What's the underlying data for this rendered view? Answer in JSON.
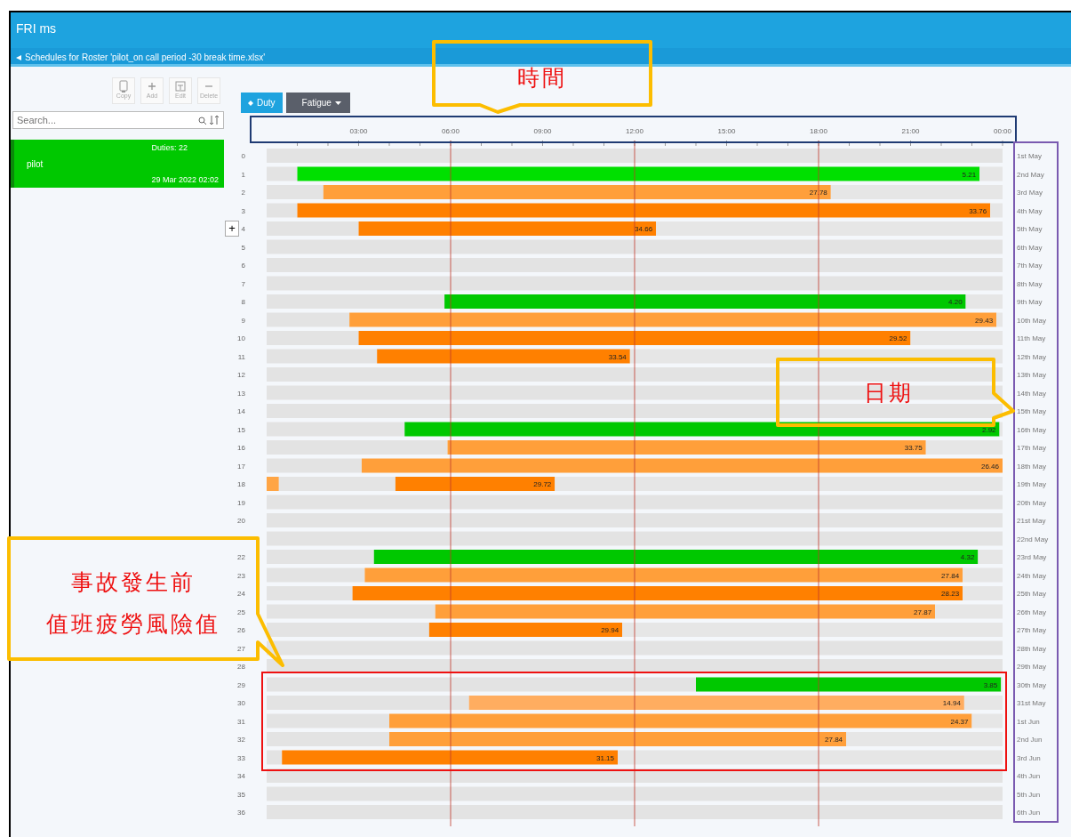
{
  "header": {
    "title": "FRI ms",
    "subtitle": "Schedules for Roster 'pilot_on call period -30 break time.xlsx'"
  },
  "toolbar": [
    {
      "kind": "copy",
      "label": "Copy"
    },
    {
      "kind": "add",
      "label": "Add"
    },
    {
      "kind": "edit",
      "label": "Edit"
    },
    {
      "kind": "delete",
      "label": "Delete"
    }
  ],
  "search": {
    "placeholder": "Search..."
  },
  "rosters": [
    {
      "name": "pilot",
      "duties": "Duties: 22",
      "date": "29 Mar 2022 02:02",
      "selected": true
    }
  ],
  "view_buttons": [
    {
      "kind": "duty",
      "label": "Duty",
      "selected": true
    },
    {
      "kind": "fatigue",
      "label": "Fatigue",
      "selected": false
    }
  ],
  "expand_button": {
    "label": "+"
  },
  "chart": {
    "dates": [
      "1st May",
      "2nd May",
      "3rd May",
      "4th May",
      "5th May",
      "6th May",
      "7th May",
      "8th May",
      "9th May",
      "10th May",
      "11th May",
      "12th May",
      "13th May",
      "14th May",
      "15th May",
      "16th May",
      "17th May",
      "18th May",
      "19th May",
      "20th May",
      "21st May",
      "22nd May",
      "23rd May",
      "24th May",
      "25th May",
      "26th May",
      "27th May",
      "28th May",
      "29th May",
      "30th May",
      "31st May",
      "1st Jun",
      "2nd Jun",
      "3rd Jun",
      "4th Jun",
      "5th Jun",
      "6th Jun"
    ],
    "chart_data": {
      "type": "bar",
      "orientation": "horizontal",
      "stacked": true,
      "grid": true,
      "xlim": [
        0,
        24
      ],
      "xticks": [
        {
          "value": 3,
          "label": "03:00"
        },
        {
          "value": 6,
          "label": "06:00"
        },
        {
          "value": 9,
          "label": "09:00"
        },
        {
          "value": 12,
          "label": "12:00"
        },
        {
          "value": 15,
          "label": "15:00"
        },
        {
          "value": 18,
          "label": "18:00"
        },
        {
          "value": 21,
          "label": "21:00"
        },
        {
          "value": 24,
          "label": "00:00"
        }
      ],
      "categories": [
        "0",
        "1",
        "2",
        "3",
        "4",
        "5",
        "6",
        "7",
        "8",
        "9",
        "10",
        "11",
        "12",
        "13",
        "14",
        "15",
        "16",
        "17",
        "18",
        "19",
        "20",
        null,
        "22",
        "23",
        "24",
        "25",
        "26",
        "27",
        "28",
        "29",
        "30",
        "31",
        "32",
        "33",
        "34",
        "35",
        "36"
      ],
      "series": [
        {
          "color": "#e3e3e3",
          "values": [
            24,
            1.0,
            1.85,
            1.0,
            3.0,
            24,
            24,
            24,
            5.8,
            2.7,
            3.0,
            3.6,
            24,
            24,
            24,
            4.5,
            5.9,
            3.1,
            null,
            24,
            24,
            24,
            3.5,
            3.2,
            2.8,
            5.5,
            5.3,
            24,
            24,
            14.0,
            6.6,
            4.0,
            4.0,
            0.5,
            24,
            24,
            24
          ]
        },
        {
          "color": "#ffa545",
          "values": [
            null,
            null,
            null,
            null,
            null,
            null,
            null,
            null,
            null,
            null,
            null,
            null,
            null,
            null,
            null,
            null,
            null,
            null,
            0.4,
            null,
            null,
            null,
            null,
            null,
            null,
            null,
            null,
            null,
            null,
            null,
            null,
            null,
            null,
            null,
            null,
            null,
            null
          ]
        },
        {
          "color": "#e4e4e4",
          "values": [
            null,
            null,
            null,
            null,
            null,
            null,
            null,
            null,
            null,
            null,
            null,
            null,
            null,
            null,
            null,
            null,
            null,
            null,
            3.8,
            null,
            null,
            null,
            null,
            null,
            null,
            null,
            null,
            null,
            null,
            null,
            null,
            null,
            null,
            null,
            null,
            null,
            null
          ]
        },
        {
          "color": "#00e000",
          "values": [
            null,
            22.25,
            null,
            null,
            null,
            null,
            null,
            null,
            null,
            null,
            null,
            null,
            null,
            null,
            null,
            null,
            null,
            null,
            null,
            null,
            null,
            null,
            null,
            null,
            null,
            null,
            null,
            null,
            null,
            null,
            null,
            null,
            null,
            null,
            null,
            null,
            null
          ]
        },
        {
          "color": "#00c800",
          "values": [
            null,
            null,
            null,
            null,
            null,
            null,
            null,
            null,
            17.0,
            null,
            null,
            null,
            null,
            null,
            null,
            19.4,
            null,
            null,
            null,
            null,
            null,
            null,
            19.7,
            null,
            null,
            null,
            null,
            null,
            null,
            9.95,
            null,
            null,
            null,
            null,
            null,
            null,
            null
          ]
        },
        {
          "color": "#ff9f3a",
          "values": [
            null,
            null,
            16.55,
            null,
            null,
            null,
            null,
            null,
            null,
            21.1,
            null,
            null,
            null,
            null,
            null,
            null,
            15.6,
            20.9,
            null,
            null,
            null,
            null,
            null,
            19.5,
            null,
            16.3,
            null,
            null,
            null,
            null,
            null,
            19.0,
            14.9,
            null,
            null,
            null,
            null
          ]
        },
        {
          "color": "#ff8000",
          "values": [
            null,
            null,
            null,
            22.6,
            9.7,
            null,
            null,
            null,
            null,
            null,
            18.0,
            8.25,
            null,
            null,
            null,
            null,
            null,
            null,
            5.2,
            null,
            null,
            null,
            null,
            null,
            19.9,
            null,
            6.3,
            null,
            null,
            null,
            null,
            null,
            null,
            10.95,
            null,
            null,
            null
          ]
        },
        {
          "color": "#ffad60",
          "values": [
            null,
            null,
            null,
            null,
            null,
            null,
            null,
            null,
            null,
            null,
            null,
            null,
            null,
            null,
            null,
            null,
            null,
            null,
            null,
            null,
            null,
            null,
            null,
            null,
            null,
            null,
            null,
            null,
            null,
            null,
            16.15,
            null,
            null,
            null,
            null,
            null,
            null
          ]
        },
        {
          "color": "#e6e6e6",
          "values": [
            null,
            0.75,
            5.6,
            0.4,
            11.3,
            null,
            null,
            null,
            1.2,
            0.2,
            3.0,
            12.15,
            null,
            null,
            null,
            0.1,
            2.5,
            null,
            14.6,
            null,
            null,
            null,
            0.8,
            1.3,
            1.3,
            2.2,
            12.4,
            null,
            null,
            0.05,
            1.25,
            1.0,
            5.1,
            12.55,
            null,
            null,
            null
          ]
        }
      ],
      "annotations": [
        {
          "x": 23.25,
          "y": "1",
          "text": "5.21"
        },
        {
          "x": 18.4,
          "y": "2",
          "text": "27.78"
        },
        {
          "x": 23.6,
          "y": "3",
          "text": "33.76"
        },
        {
          "x": 12.7,
          "y": "4",
          "text": "34.66"
        },
        {
          "x": 22.8,
          "y": "8",
          "text": "4.20"
        },
        {
          "x": 23.8,
          "y": "9",
          "text": "29.43"
        },
        {
          "x": 21.0,
          "y": "10",
          "text": "29.52"
        },
        {
          "x": 11.85,
          "y": "11",
          "text": "33.54"
        },
        {
          "x": 23.9,
          "y": "15",
          "text": "2.92"
        },
        {
          "x": 21.5,
          "y": "16",
          "text": "33.75"
        },
        {
          "x": 24.0,
          "y": "17",
          "text": "26.46"
        },
        {
          "x": 9.4,
          "y": "18",
          "text": "29.72"
        },
        {
          "x": 23.2,
          "y": "22",
          "text": "4.32"
        },
        {
          "x": 22.7,
          "y": "23",
          "text": "27.84"
        },
        {
          "x": 22.7,
          "y": "24",
          "text": "28.23"
        },
        {
          "x": 21.8,
          "y": "25",
          "text": "27.87"
        },
        {
          "x": 11.6,
          "y": "26",
          "text": "29.94"
        },
        {
          "x": 23.95,
          "y": "29",
          "text": "3.85"
        },
        {
          "x": 22.75,
          "y": "30",
          "text": "14.94"
        },
        {
          "x": 23.0,
          "y": "31",
          "text": "24.37"
        },
        {
          "x": 18.9,
          "y": "32",
          "text": "27.84"
        },
        {
          "x": 11.45,
          "y": "33",
          "text": "31.15"
        }
      ]
    }
  },
  "annotations": [
    {
      "kind": "time",
      "lines": [
        "時間"
      ]
    },
    {
      "kind": "date",
      "lines": [
        "日期"
      ]
    },
    {
      "kind": "risk",
      "lines": [
        "事故發生前",
        "值班疲勞風險值"
      ]
    }
  ]
}
